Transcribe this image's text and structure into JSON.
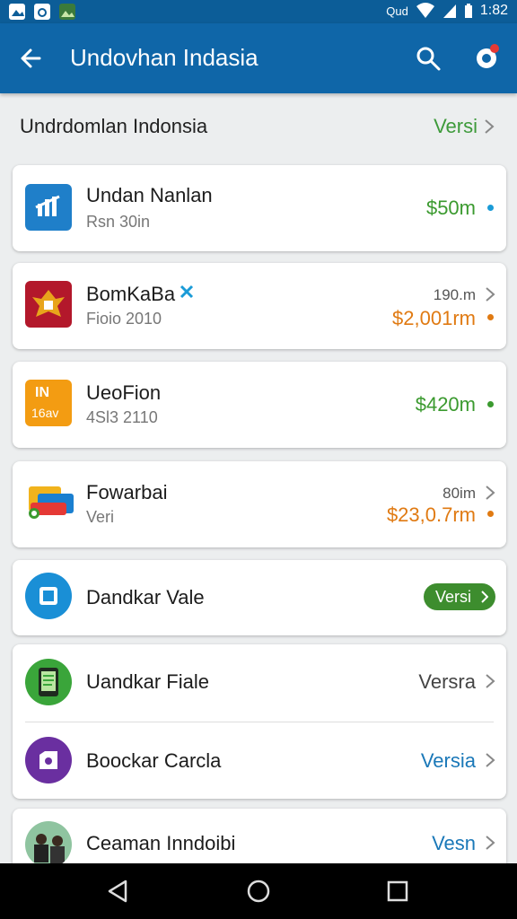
{
  "status_bar": {
    "signal_text": "Qud",
    "time": "1:82"
  },
  "app_bar": {
    "title": "Undovhan Indasia"
  },
  "section": {
    "title": "Undrdomlan Indonsia",
    "link_label": "Versi"
  },
  "items": [
    {
      "name": "Undan Nanlan",
      "sub": "Rsn 30in",
      "price": "$50m",
      "price_color": "#3b9a2f",
      "icon": "chart-app-icon"
    },
    {
      "name": "BomKaBa",
      "sub": "Fioio 2010",
      "small": "190.m",
      "price": "$2,001rm",
      "price_color": "#e07a12",
      "icon": "garuda-emblem-icon"
    },
    {
      "name": "UeoFion",
      "sub": "4Sl3 2110",
      "price": "$420m",
      "price_color": "#3b9a2f",
      "icon": "orange-app-icon",
      "icon_text_top": "IN",
      "icon_text_bottom": "16av"
    },
    {
      "name": "Fowarbai",
      "sub": "Veri",
      "small": "80im",
      "price": "$23,0.7rm",
      "price_color": "#e07a12",
      "icon": "folders-app-icon"
    },
    {
      "name": "Dandkar Vale",
      "pill": "Versi",
      "icon": "blue-circle-app-icon"
    },
    {
      "name": "Uandkar Fiale",
      "link": "Versra",
      "link_color": "#444444",
      "icon": "tablet-app-icon"
    },
    {
      "name": "Boockar Carcla",
      "link": "Versia",
      "link_color": "#1a78b8",
      "icon": "purple-circle-app-icon"
    },
    {
      "name": "Ceaman Inndoibi",
      "link": "Vesn",
      "link_color": "#1a78b8",
      "icon": "people-photo-icon"
    }
  ],
  "colors": {
    "primary": "#0f66a8",
    "green": "#3b9a2f",
    "orange": "#e07a12",
    "link_blue": "#1a78b8"
  }
}
